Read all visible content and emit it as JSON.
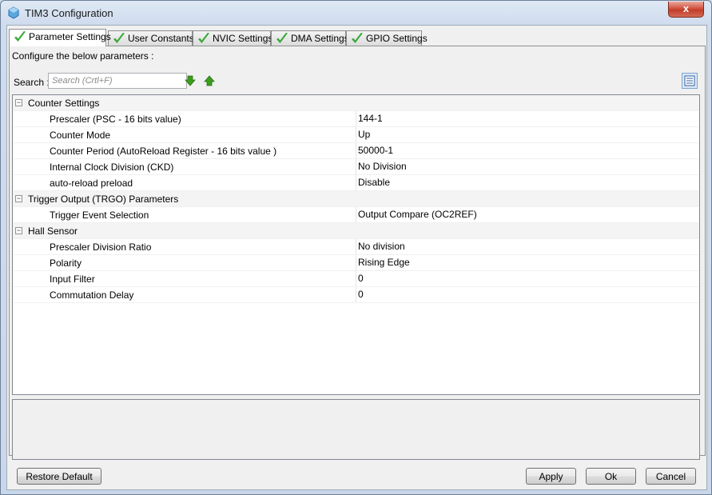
{
  "window": {
    "title": "TIM3 Configuration",
    "close_label": "x"
  },
  "tabs": [
    {
      "label": "Parameter Settings",
      "active": true
    },
    {
      "label": "User Constants"
    },
    {
      "label": "NVIC Settings"
    },
    {
      "label": "DMA Settings"
    },
    {
      "label": "GPIO Settings"
    }
  ],
  "panel": {
    "configure_label": "Configure the below parameters :",
    "search_label": "Search :",
    "search_placeholder": "Search (Crtl+F)"
  },
  "groups": [
    {
      "label": "Counter Settings",
      "params": [
        {
          "name": "Prescaler (PSC - 16 bits value)",
          "value": "144-1"
        },
        {
          "name": "Counter Mode",
          "value": "Up"
        },
        {
          "name": "Counter Period (AutoReload Register - 16 bits value )",
          "value": "50000-1"
        },
        {
          "name": "Internal Clock Division (CKD)",
          "value": "No Division"
        },
        {
          "name": "auto-reload preload",
          "value": "Disable"
        }
      ]
    },
    {
      "label": "Trigger Output (TRGO) Parameters",
      "params": [
        {
          "name": "Trigger Event Selection",
          "value": "Output Compare (OC2REF)"
        }
      ]
    },
    {
      "label": "Hall Sensor",
      "params": [
        {
          "name": "Prescaler Division Ratio",
          "value": "No division"
        },
        {
          "name": "Polarity",
          "value": "Rising Edge"
        },
        {
          "name": "Input Filter",
          "value": "0"
        },
        {
          "name": "Commutation Delay",
          "value": "0"
        }
      ]
    }
  ],
  "buttons": {
    "restore_default": "Restore Default",
    "apply": "Apply",
    "ok": "Ok",
    "cancel": "Cancel"
  },
  "colors": {
    "check_green": "#3aa83a",
    "arrow_green": "#3c9c1e"
  }
}
